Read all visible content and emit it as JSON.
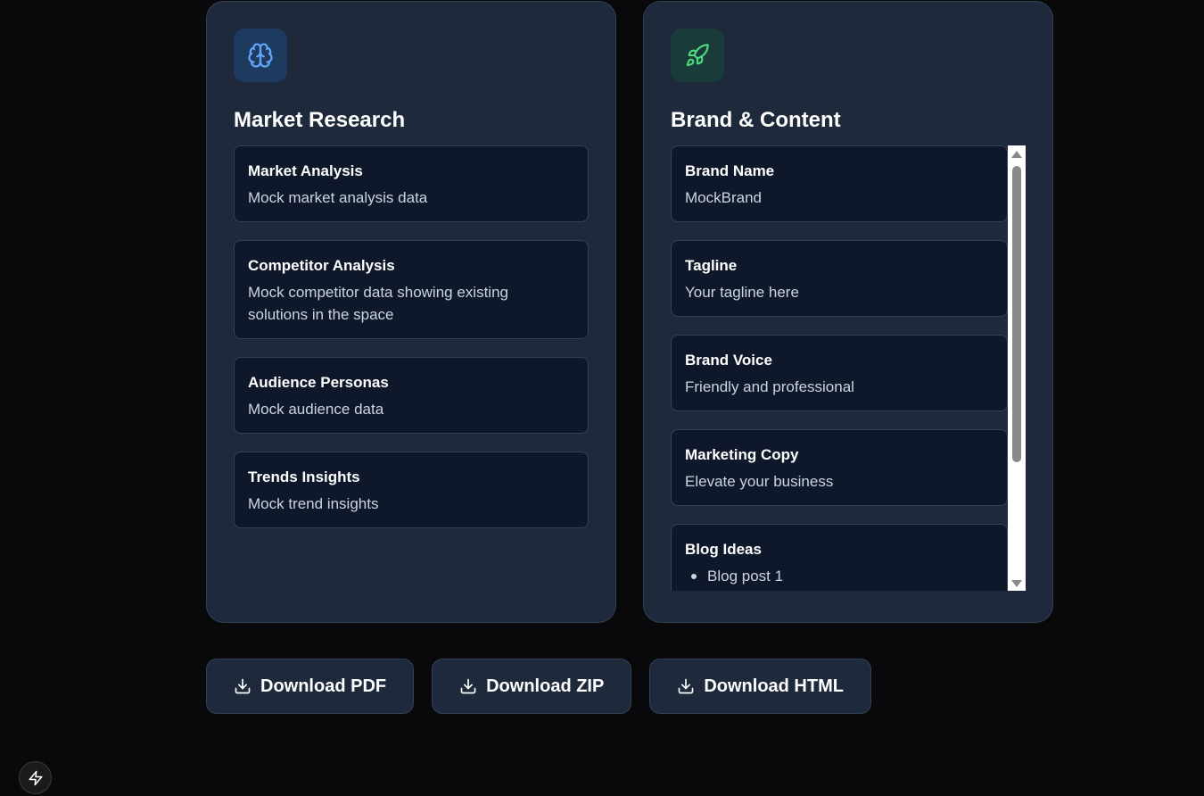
{
  "market_research": {
    "title": "Market Research",
    "icon": "brain-icon",
    "accent": "#60a5fa",
    "cards": [
      {
        "title": "Market Analysis",
        "body": "Mock market analysis data"
      },
      {
        "title": "Competitor Analysis",
        "body": "Mock competitor data showing existing solutions in the space"
      },
      {
        "title": "Audience Personas",
        "body": "Mock audience data"
      },
      {
        "title": "Trends Insights",
        "body": "Mock trend insights"
      }
    ]
  },
  "brand_content": {
    "title": "Brand & Content",
    "icon": "rocket-icon",
    "accent": "#4ade80",
    "cards": [
      {
        "title": "Brand Name",
        "body": "MockBrand"
      },
      {
        "title": "Tagline",
        "body": "Your tagline here"
      },
      {
        "title": "Brand Voice",
        "body": "Friendly and professional"
      },
      {
        "title": "Marketing Copy",
        "body": "Elevate your business"
      }
    ],
    "blog": {
      "title": "Blog Ideas",
      "items": [
        "Blog post 1"
      ]
    }
  },
  "actions": {
    "download_pdf": "Download PDF",
    "download_zip": "Download ZIP",
    "download_html": "Download HTML"
  }
}
